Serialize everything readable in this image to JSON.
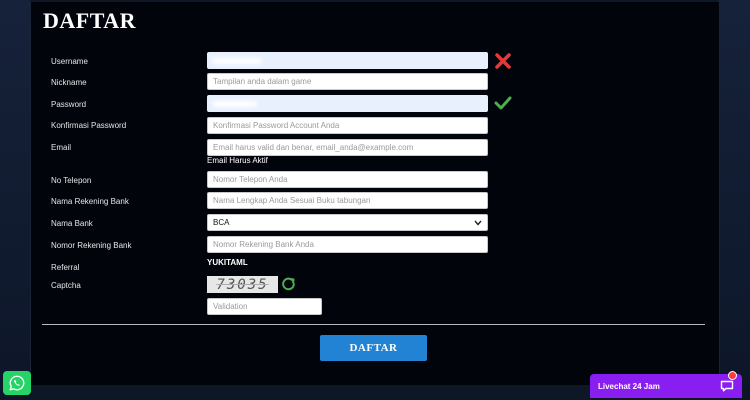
{
  "form": {
    "title": "DAFTAR",
    "labels": {
      "username": "Username",
      "nickname": "Nickname",
      "password": "Password",
      "confirm_password": "Konfirmasi Password",
      "email": "Email",
      "phone": "No Telepon",
      "account_name": "Nama Rekening Bank",
      "bank_name": "Nama Bank",
      "account_number": "Nomor Rekening Bank",
      "referral": "Referral",
      "captcha": "Captcha"
    },
    "placeholders": {
      "nickname": "Tampilan anda dalam game",
      "confirm_password": "Konfirmasi Password Account Anda",
      "email": "Email harus valid dan benar, email_anda@example.com",
      "phone": "Nomor Telepon Anda",
      "account_name": "Nama Lengkap Anda Sesuai Buku tabungan",
      "account_number": "Nomor Rekening Bank Anda",
      "captcha": "Validation"
    },
    "email_hint": "Email Harus Aktif",
    "bank_selected": "BCA",
    "referral_code": "YUKITAML",
    "captcha_text": "73035",
    "submit_label": "DAFTAR",
    "status_colors": {
      "invalid": "#e53935",
      "valid": "#4caf50"
    }
  },
  "widgets": {
    "whatsapp_icon": "whatsapp-icon",
    "livechat_label": "Livechat 24 Jam",
    "livechat_color": "#8a1df0"
  }
}
